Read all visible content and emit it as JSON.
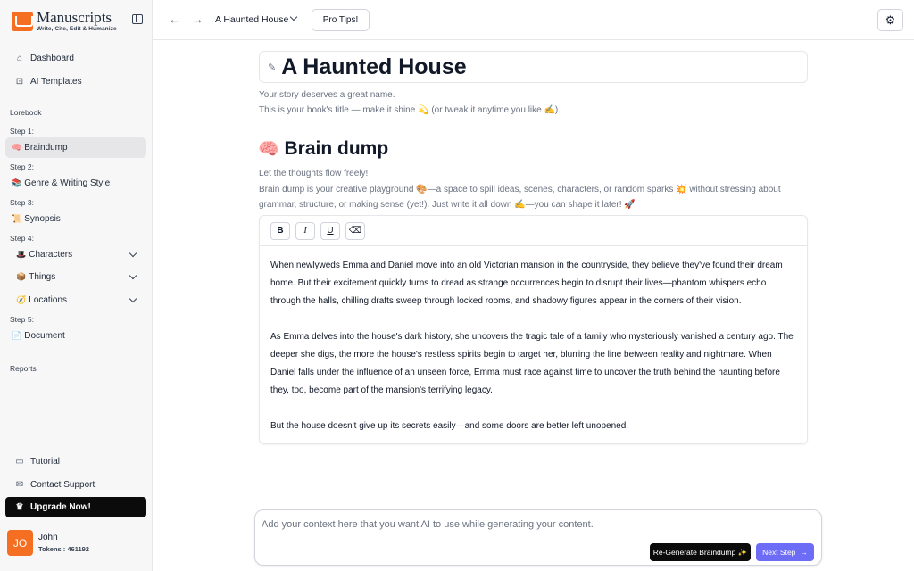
{
  "brand": {
    "name": "Manuscripts",
    "tagline": "Write, Cite, Edit & Humanize"
  },
  "nav": {
    "dashboard": "Dashboard",
    "ai_templates": "AI Templates",
    "lorebook": "Lorebook",
    "step1": "Step 1:",
    "braindump": "Braindump",
    "step2": "Step 2:",
    "genre": "Genre & Writing Style",
    "step3": "Step 3:",
    "synopsis": "Synopsis",
    "step4": "Step 4:",
    "characters": "Characters",
    "things": "Things",
    "locations": "Locations",
    "step5": "Step 5:",
    "document": "Document",
    "reports": "Reports"
  },
  "footer_nav": {
    "tutorial": "Tutorial",
    "contact": "Contact Support",
    "upgrade": "Upgrade Now!"
  },
  "user": {
    "initials": "JO",
    "name": "John",
    "tokens": "Tokens : 461192"
  },
  "topbar": {
    "doc_title": "A Haunted House",
    "pro_tips": "Pro Tips!"
  },
  "main": {
    "title": "A Haunted House",
    "title_hint1": "Your story deserves a great name.",
    "title_hint2": "This is your book's title — make it shine 💫 (or tweak it anytime you like ✍️).",
    "section_title": "Brain dump",
    "section_hint1": "Let the thoughts flow freely!",
    "section_hint2": "Brain dump is your creative playground 🎨—a space to spill ideas, scenes, characters, or random sparks 💥 without stressing about",
    "section_hint3": "grammar, structure, or making sense (yet!). Just write it all down ✍️—you can shape it later! 🚀"
  },
  "editor": {
    "toolbar": {
      "bold": "B",
      "italic": "I",
      "underline": "U"
    },
    "paragraphs": [
      "When newlyweds Emma and Daniel move into an old Victorian mansion in the countryside, they believe they've found their dream home. But their excitement quickly turns to dread as strange occurrences begin to disrupt their lives—phantom whispers echo through the halls, chilling drafts sweep through locked rooms, and shadowy figures appear in the corners of their vision.",
      "As Emma delves into the house's dark history, she uncovers the tragic tale of a family who mysteriously vanished a century ago. The deeper she digs, the more the house's restless spirits begin to target her, blurring the line between reality and nightmare. When Daniel falls under the influence of an unseen force, Emma must race against time to uncover the truth behind the haunting before they, too, become part of the mansion's terrifying legacy.",
      "But the house doesn't give up its secrets easily—and some doors are better left unopened."
    ]
  },
  "context": {
    "placeholder": "Add your context here that you want AI to use while generating your content.",
    "regen": "Re-Generate Braindump ✨",
    "next": "Next Step"
  }
}
